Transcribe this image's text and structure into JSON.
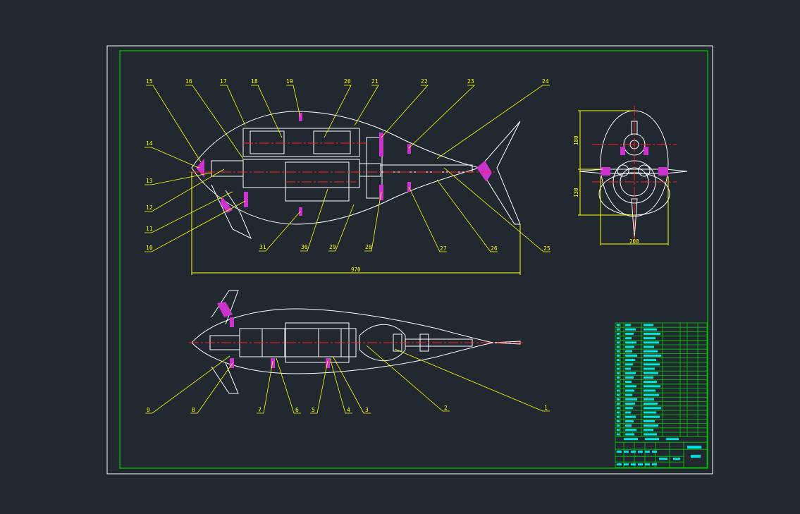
{
  "colors": {
    "background": "#212830",
    "outline": "#ffffff",
    "frame": "#00cc00",
    "leader": "#ffff00",
    "centerline": "#ff2020",
    "hatch": "#cc33cc",
    "table_fill": "#00e5e5"
  },
  "top_view": {
    "callouts": [
      "15",
      "16",
      "17",
      "18",
      "19",
      "20",
      "21",
      "22",
      "23",
      "24"
    ],
    "left_callouts": [
      "14",
      "13",
      "12",
      "11",
      "10"
    ],
    "bottom_callouts": [
      "31",
      "30",
      "29",
      "28",
      "27",
      "26",
      "25"
    ],
    "length_dim": "970"
  },
  "end_view": {
    "height_upper_dim": "180",
    "height_lower_dim": "130",
    "width_dim": "200"
  },
  "side_view": {
    "callouts": [
      "9",
      "8",
      "7",
      "6",
      "5",
      "4",
      "3",
      "2",
      "1"
    ]
  },
  "parts_table": {
    "rows": 26
  }
}
